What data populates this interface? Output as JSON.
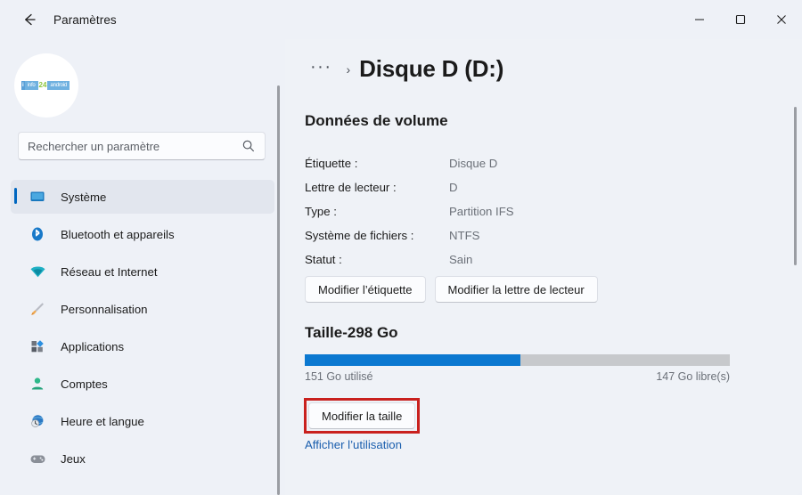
{
  "window": {
    "title": "Paramètres",
    "back_icon": "arrow-left-icon",
    "controls": {
      "minimize": "minimize-icon",
      "maximize": "maximize-icon",
      "close": "close-icon"
    }
  },
  "sidebar": {
    "avatar": {
      "icon": "user-avatar",
      "logo_parts": [
        "i",
        "info",
        "24",
        "android"
      ]
    },
    "search": {
      "placeholder": "Rechercher un paramètre",
      "value": "",
      "icon": "search-icon"
    },
    "items": [
      {
        "label": "Système",
        "icon": "monitor-icon",
        "active": true
      },
      {
        "label": "Bluetooth et appareils",
        "icon": "bluetooth-icon",
        "active": false
      },
      {
        "label": "Réseau et Internet",
        "icon": "wifi-icon",
        "active": false
      },
      {
        "label": "Personnalisation",
        "icon": "paintbrush-icon",
        "active": false
      },
      {
        "label": "Applications",
        "icon": "apps-icon",
        "active": false
      },
      {
        "label": "Comptes",
        "icon": "person-icon",
        "active": false
      },
      {
        "label": "Heure et langue",
        "icon": "clock-globe-icon",
        "active": false
      },
      {
        "label": "Jeux",
        "icon": "gamepad-icon",
        "active": false
      }
    ]
  },
  "main": {
    "breadcrumb": {
      "ellipsis": "···",
      "separator": "›",
      "current": "Disque D (D:)"
    },
    "volume_section": {
      "heading": "Données de volume",
      "rows": [
        {
          "label": "Étiquette :",
          "value": "Disque D"
        },
        {
          "label": "Lettre de lecteur :",
          "value": "D"
        },
        {
          "label": "Type :",
          "value": "Partition IFS"
        },
        {
          "label": "Système de fichiers :",
          "value": "NTFS"
        },
        {
          "label": "Statut :",
          "value": "Sain"
        }
      ],
      "buttons": [
        {
          "label": "Modifier l’étiquette"
        },
        {
          "label": "Modifier la lettre de lecteur"
        }
      ]
    },
    "size_section": {
      "heading": "Taille-298 Go",
      "used_label": "151 Go utilisé",
      "free_label": "147 Go libre(s)",
      "used_percent": 50.7,
      "resize_button": "Modifier la taille",
      "usage_link": "Afficher l’utilisation"
    }
  },
  "colors": {
    "accent": "#0b78d0",
    "selection_bar": "#0067c0",
    "highlight_box": "#c9211e",
    "link": "#1b5fae",
    "track": "#c7c9cc",
    "sidebar_bg": "#eef1f7",
    "content_bg": "#eff2f7"
  }
}
